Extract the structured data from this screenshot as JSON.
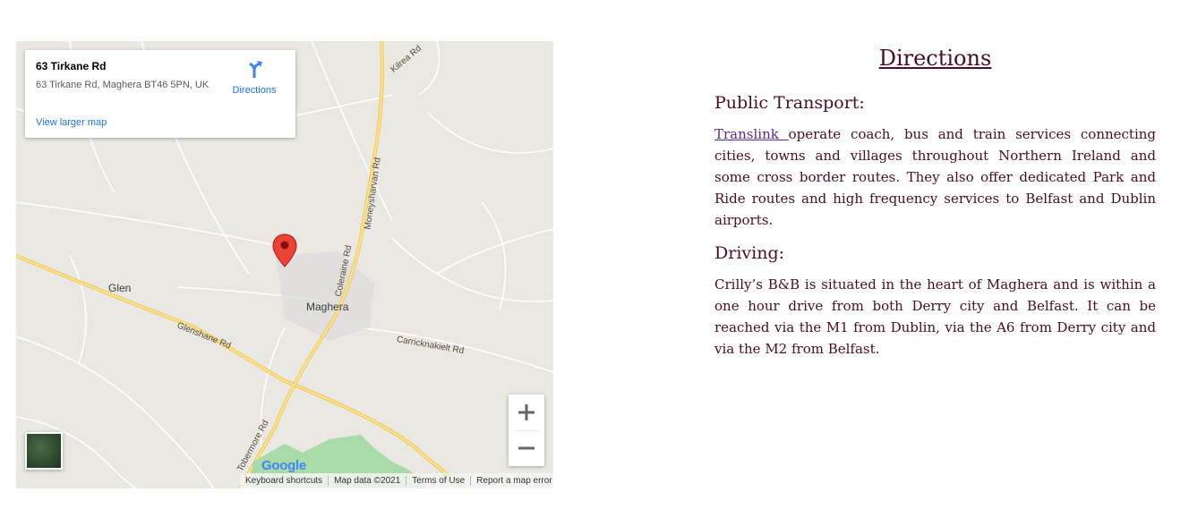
{
  "map": {
    "info_card": {
      "title": "63 Tirkane Rd",
      "address": "63 Tirkane Rd, Maghera BT46 5PN, UK",
      "larger_map_link": "View larger map",
      "directions_label": "Directions"
    },
    "road_labels": {
      "kilrea": "Kilrea Rd",
      "moneysharvan": "Moneysharvan Rd",
      "coleraine": "Coleraine Rd",
      "glenshane": "Glenshane Rd",
      "carricknakielt": "Carricknakielt Rd",
      "tobermore": "Tobermore Rd",
      "gl_partial": "Gl"
    },
    "place_labels": {
      "glen": "Glen",
      "maghera": "Maghera"
    },
    "zoom_in": "+",
    "zoom_out": "−",
    "logo": "Google",
    "footer": {
      "keyboard_shortcuts": "Keyboard shortcuts",
      "map_data": "Map data ©2021",
      "terms": "Terms of Use",
      "report": "Report a map error"
    },
    "colors": {
      "background": "#e9e8e3",
      "major_road": "#fcd66e",
      "minor_road": "#ffffff",
      "park": "#a8dba8",
      "pin": "#ea4335"
    }
  },
  "content": {
    "title": "Directions",
    "public_transport": {
      "heading": "Public Transport:",
      "link_text": "Translink ",
      "text": "operate coach, bus and train services connecting cities, towns and villages throughout Northern Ireland and some cross border routes. They also offer dedicated Park and Ride routes and high frequency services to Belfast and Dublin airports."
    },
    "driving": {
      "heading": "Driving:",
      "text": "Crilly’s B&B is situated in the heart of Maghera and is within a one hour drive from both Derry city and Belfast. It can be reached via the M1 from Dublin, via the A6 from Derry city and via the M2 from Belfast."
    },
    "colors": {
      "text": "#4a0e1e",
      "link": "#5a2a8a"
    }
  }
}
